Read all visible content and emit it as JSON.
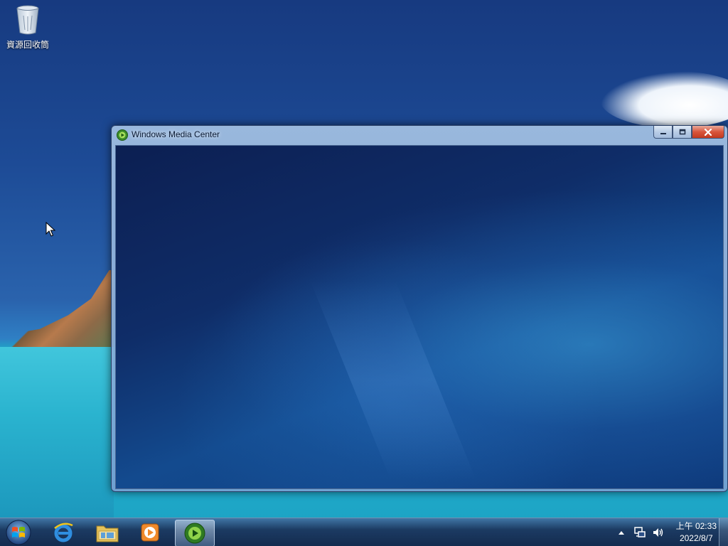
{
  "desktop": {
    "icons": [
      {
        "label": "資源回收筒",
        "icon": "recycle-bin-icon"
      }
    ]
  },
  "window": {
    "title": "Windows Media Center",
    "icon": "media-center-icon",
    "controls": {
      "minimize": "minimize-icon",
      "maximize": "maximize-icon",
      "close": "close-icon"
    }
  },
  "taskbar": {
    "start": "start-orb-icon",
    "pinned": [
      {
        "name": "internet-explorer",
        "icon": "internet-explorer-icon"
      },
      {
        "name": "windows-explorer",
        "icon": "folder-icon"
      },
      {
        "name": "media-player",
        "icon": "media-player-icon"
      },
      {
        "name": "media-center",
        "icon": "media-center-icon",
        "active": true
      }
    ],
    "tray": {
      "icons": [
        "show-hidden-icons-icon",
        "network-icon",
        "volume-icon"
      ],
      "time": "上午 02:33",
      "date": "2022/8/7"
    }
  },
  "colors": {
    "accent": "#1d4b96",
    "close_button": "#c23a1f"
  }
}
